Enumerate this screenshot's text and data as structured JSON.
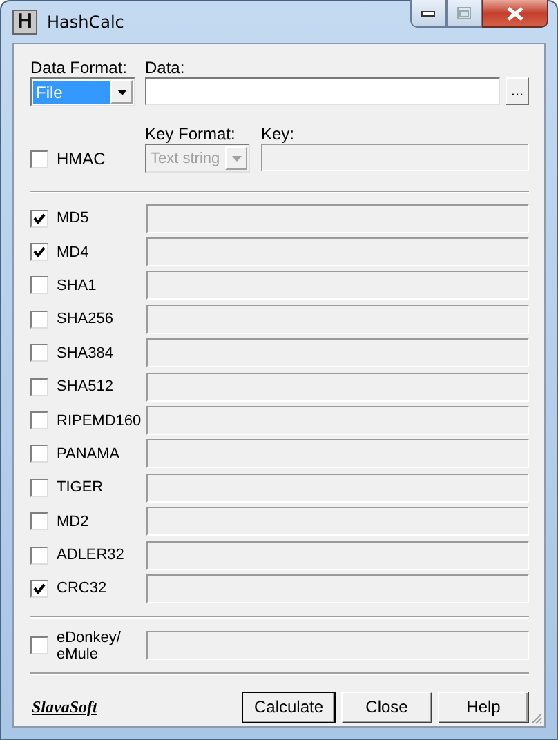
{
  "window": {
    "icon_letter": "H",
    "title": "HashCalc"
  },
  "data_format": {
    "label": "Data Format:",
    "value": "File"
  },
  "data": {
    "label": "Data:",
    "browse": "..."
  },
  "hmac": {
    "label": "HMAC",
    "checked": false
  },
  "key_format": {
    "label": "Key Format:",
    "value": "Text string",
    "disabled": true
  },
  "key": {
    "label": "Key:",
    "disabled": true
  },
  "hashes": [
    {
      "label": "MD5",
      "checked": true
    },
    {
      "label": "MD4",
      "checked": true
    },
    {
      "label": "SHA1",
      "checked": false
    },
    {
      "label": "SHA256",
      "checked": false
    },
    {
      "label": "SHA384",
      "checked": false
    },
    {
      "label": "SHA512",
      "checked": false
    },
    {
      "label": "RIPEMD160",
      "checked": false
    },
    {
      "label": "PANAMA",
      "checked": false
    },
    {
      "label": "TIGER",
      "checked": false
    },
    {
      "label": "MD2",
      "checked": false
    },
    {
      "label": "ADLER32",
      "checked": false
    },
    {
      "label": "CRC32",
      "checked": true
    }
  ],
  "edonkey": {
    "label": "eDonkey/ eMule",
    "checked": false
  },
  "logo": "SlavaSoft",
  "buttons": [
    "Calculate",
    "Close",
    "Help"
  ]
}
